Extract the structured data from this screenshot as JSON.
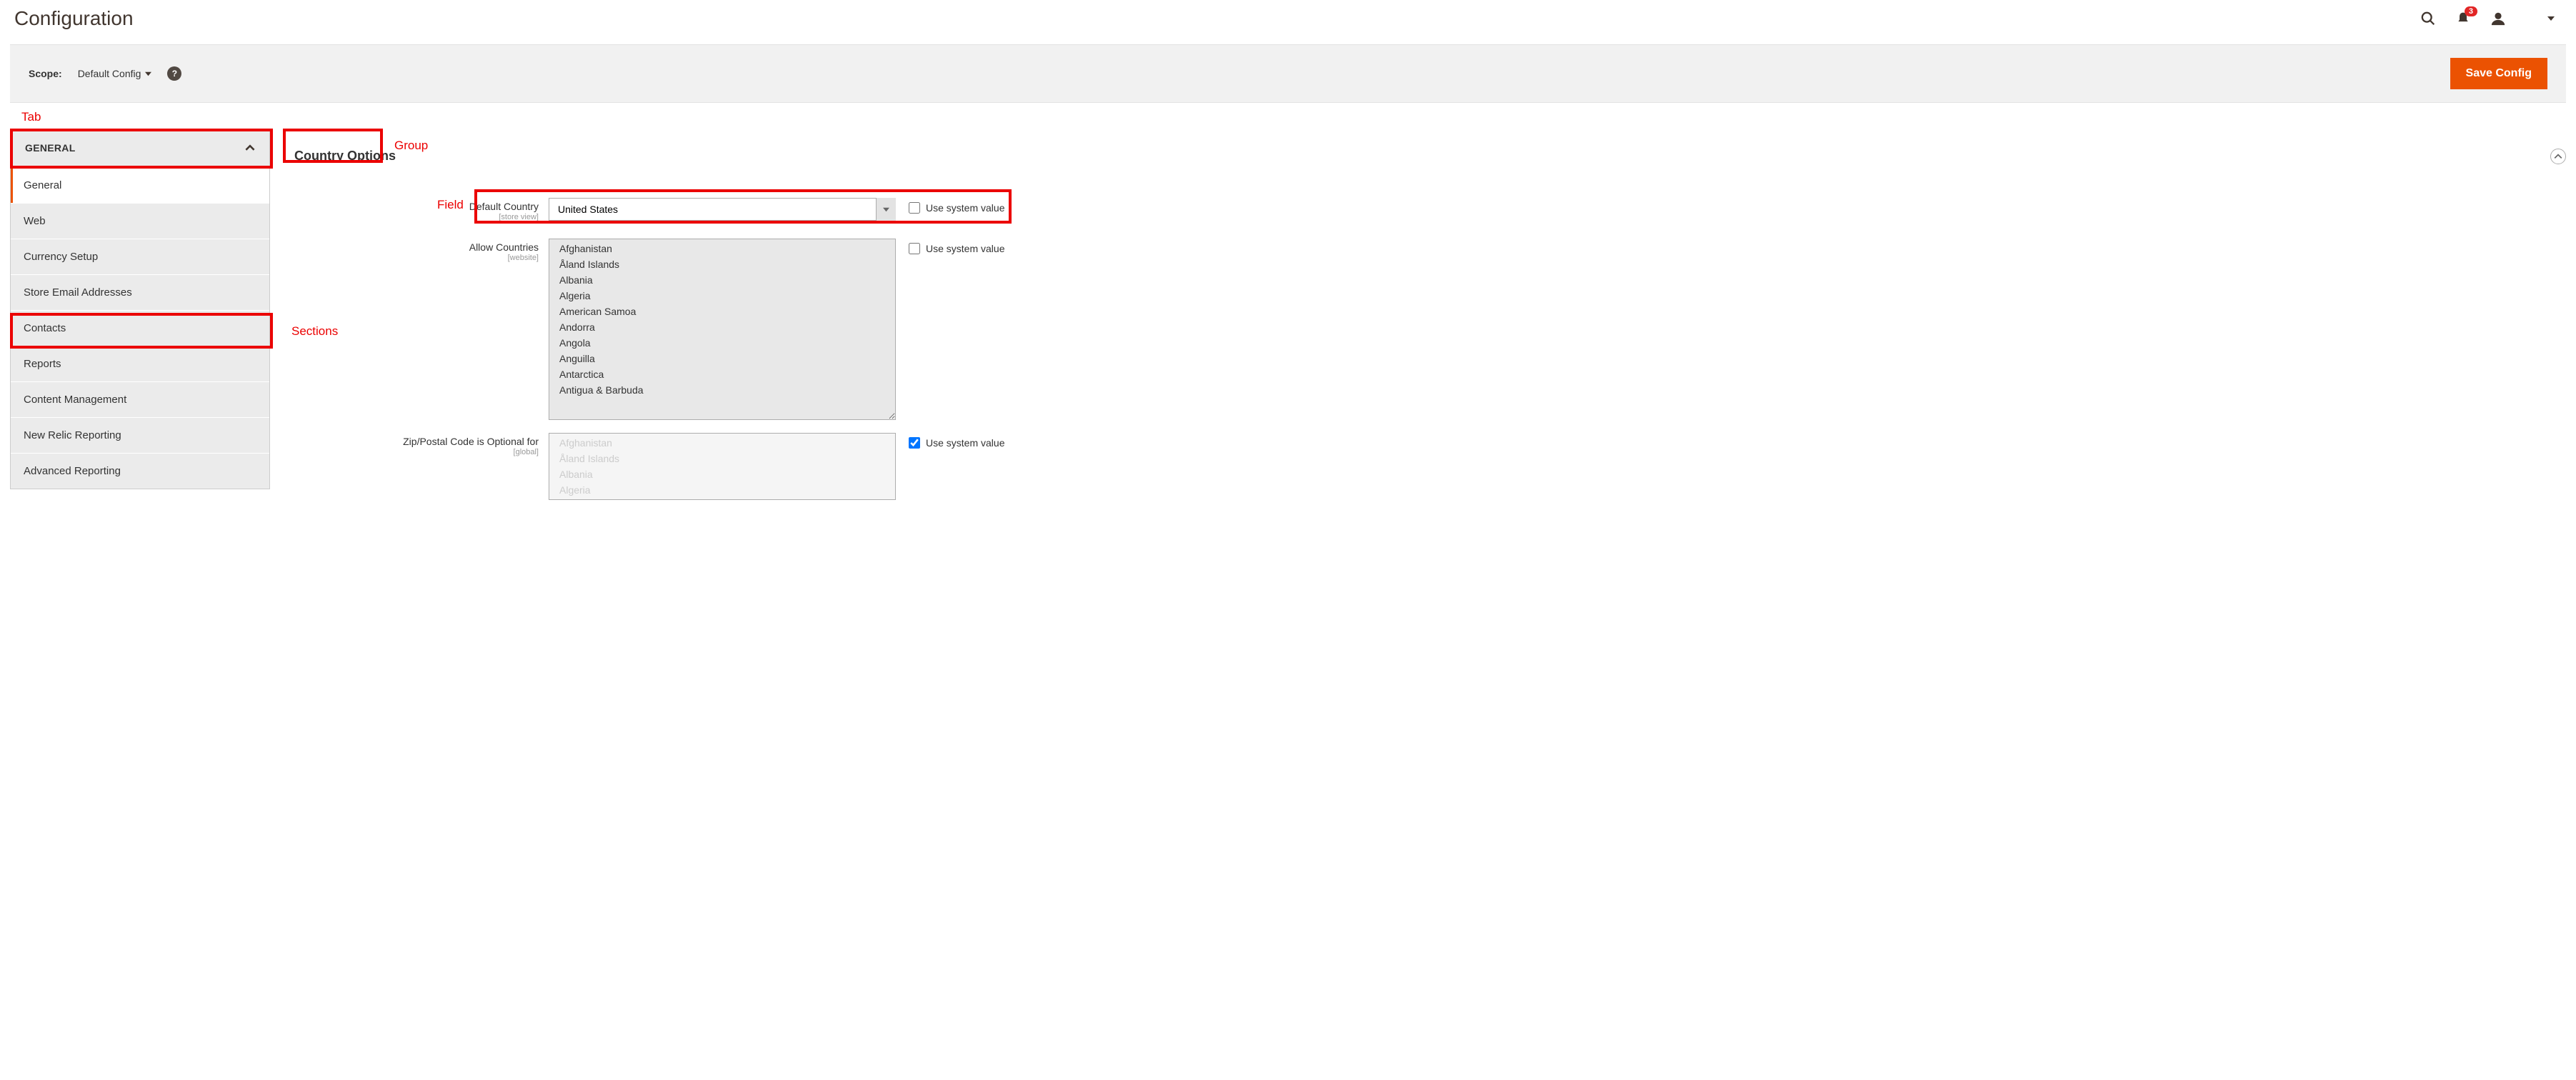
{
  "page_title": "Configuration",
  "header": {
    "notification_count": "3"
  },
  "scope": {
    "label": "Scope:",
    "value": "Default Config"
  },
  "save_button": "Save Config",
  "annotations": {
    "tab": "Tab",
    "group": "Group",
    "field": "Field",
    "sections": "Sections"
  },
  "sidebar": {
    "tab_label": "GENERAL",
    "sections": [
      {
        "label": "General",
        "active": true
      },
      {
        "label": "Web",
        "active": false
      },
      {
        "label": "Currency Setup",
        "active": false
      },
      {
        "label": "Store Email Addresses",
        "active": false
      },
      {
        "label": "Contacts",
        "active": false
      },
      {
        "label": "Reports",
        "active": false
      },
      {
        "label": "Content Management",
        "active": false
      },
      {
        "label": "New Relic Reporting",
        "active": false
      },
      {
        "label": "Advanced Reporting",
        "active": false
      }
    ]
  },
  "group": {
    "title": "Country Options"
  },
  "fields": {
    "default_country": {
      "label": "Default Country",
      "scope": "[store view]",
      "value": "United States",
      "use_system_label": "Use system value",
      "use_system_checked": false
    },
    "allow_countries": {
      "label": "Allow Countries",
      "scope": "[website]",
      "use_system_label": "Use system value",
      "use_system_checked": false,
      "options": [
        "Afghanistan",
        "Åland Islands",
        "Albania",
        "Algeria",
        "American Samoa",
        "Andorra",
        "Angola",
        "Anguilla",
        "Antarctica",
        "Antigua & Barbuda"
      ]
    },
    "zip_optional": {
      "label": "Zip/Postal Code is Optional for",
      "scope": "[global]",
      "use_system_label": "Use system value",
      "use_system_checked": true,
      "options": [
        "Afghanistan",
        "Åland Islands",
        "Albania",
        "Algeria"
      ]
    }
  }
}
